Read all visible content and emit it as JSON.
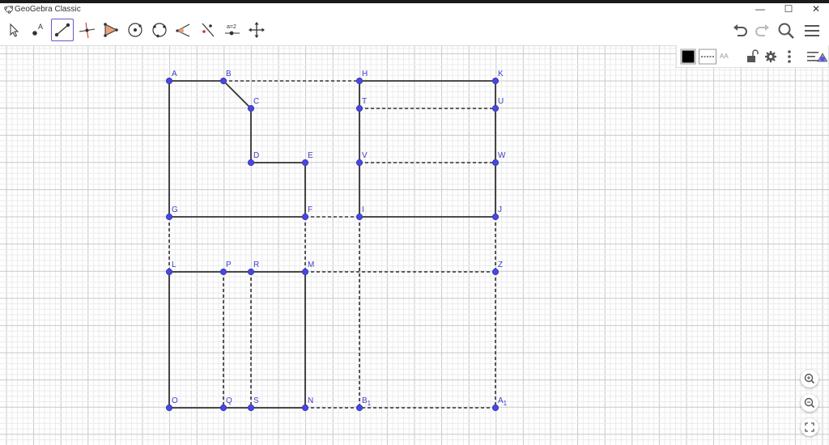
{
  "window": {
    "title": "GeoGebra Classic",
    "controls": [
      "—",
      "☐",
      "✕"
    ]
  },
  "toolbar": {
    "tools": [
      {
        "name": "move-tool-icon",
        "active": false
      },
      {
        "name": "point-tool-icon",
        "active": false
      },
      {
        "name": "segment-tool-icon",
        "active": true
      },
      {
        "name": "perpendicular-line-tool-icon",
        "active": false
      },
      {
        "name": "polygon-tool-icon",
        "active": false
      },
      {
        "name": "circle-center-point-tool-icon",
        "active": false
      },
      {
        "name": "circle-through-three-points-tool-icon",
        "active": false
      },
      {
        "name": "angle-tool-icon",
        "active": false
      },
      {
        "name": "reflect-about-line-tool-icon",
        "active": false
      },
      {
        "name": "slider-tool-icon",
        "active": false
      },
      {
        "name": "move-graphics-view-tool-icon",
        "active": false
      }
    ],
    "slider_label": "a=2",
    "right": [
      "undo-icon",
      "redo-icon",
      "search-icon",
      "menu-icon"
    ]
  },
  "stylebar": {
    "color": "#000000",
    "text_size_label": "AA",
    "items": [
      "color-swatch-icon",
      "line-style-icon",
      "text-size-icon",
      "lock-icon",
      "settings-gear-icon",
      "more-vert-icon",
      "toggle-stylebar-icon"
    ]
  },
  "graphics": {
    "labels": [
      "A",
      "B",
      "C",
      "D",
      "E",
      "F",
      "G",
      "H",
      "I",
      "J",
      "K",
      "L",
      "M",
      "N",
      "O",
      "P",
      "Q",
      "R",
      "S",
      "T",
      "U",
      "V",
      "W",
      "Z",
      "A_1",
      "B_1"
    ],
    "accent_colors": {
      "point": "#4747e6",
      "point_dark": "#3d3daf",
      "label": "#3c3ccd",
      "segment": "#333333"
    }
  },
  "zoom_controls": [
    "zoom-in-icon",
    "zoom-out-icon",
    "fullscreen-icon"
  ]
}
